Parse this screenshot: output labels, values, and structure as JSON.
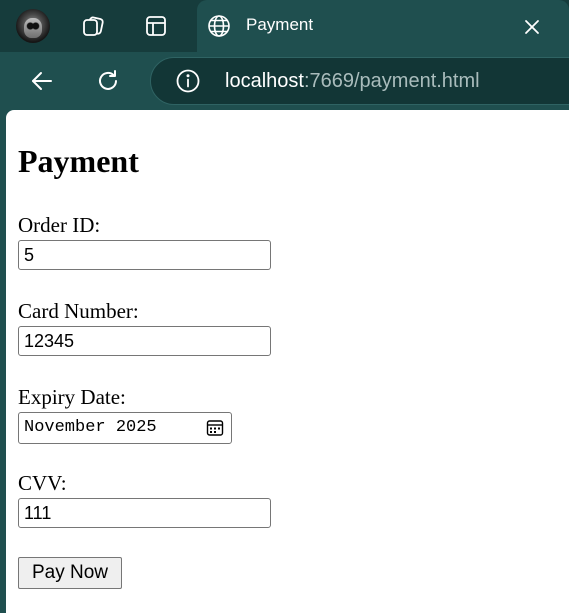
{
  "browser": {
    "tab": {
      "title": "Payment"
    },
    "address": {
      "host": "localhost",
      "rest": ":7669/payment.html"
    }
  },
  "page": {
    "heading": "Payment",
    "fields": {
      "order_id": {
        "label": "Order ID:",
        "value": "5"
      },
      "card_number": {
        "label": "Card Number:",
        "value": "12345"
      },
      "expiry": {
        "label": "Expiry Date:",
        "value": "November 2025"
      },
      "cvv": {
        "label": "CVV:",
        "value": "111"
      }
    },
    "submit_label": "Pay Now"
  },
  "icons": {
    "profile": "profile-avatar",
    "workspaces": "workspaces-icon",
    "tab_actions": "tab-actions-icon",
    "tab_favicon": "globe-icon",
    "close": "close-icon",
    "back": "back-arrow-icon",
    "reload": "reload-icon",
    "site_info": "info-icon",
    "calendar": "calendar-icon"
  },
  "colors": {
    "frame": "#163c3c",
    "toolbar": "#1f4f4f",
    "page_bg": "#ffffff",
    "button_bg": "#efefef"
  }
}
